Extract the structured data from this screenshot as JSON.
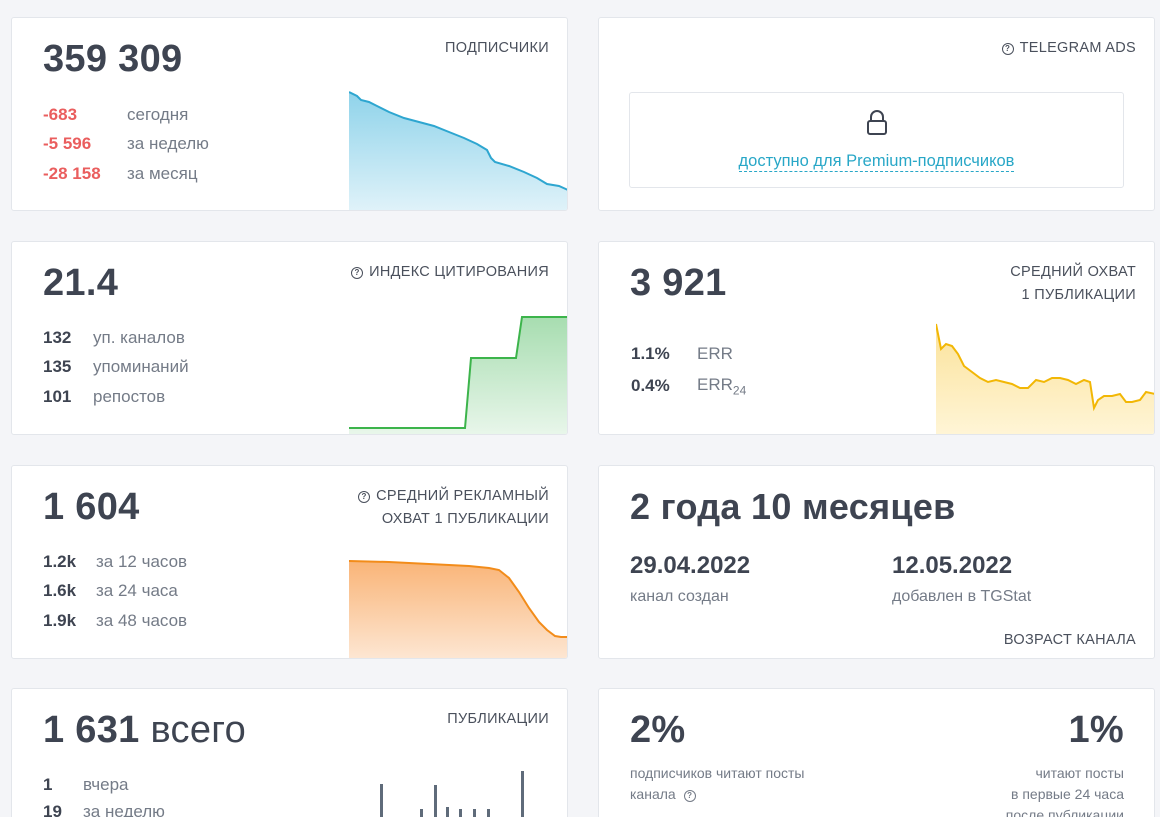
{
  "subscribers": {
    "value": "359 309",
    "label": "ПОДПИСЧИКИ",
    "rows": [
      {
        "value": "-683",
        "text": "сегодня"
      },
      {
        "value": "-5 596",
        "text": "за неделю"
      },
      {
        "value": "-28 158",
        "text": "за месяц"
      }
    ],
    "color": "#2ea6d0"
  },
  "telegram_ads": {
    "label": "TELEGRAM ADS",
    "lock_text": "доступно для Premium-подписчиков"
  },
  "citation": {
    "value": "21.4",
    "label": "ИНДЕКС ЦИТИРОВАНИЯ",
    "rows": [
      {
        "value": "132",
        "text": "уп. каналов"
      },
      {
        "value": "135",
        "text": "упоминаний"
      },
      {
        "value": "101",
        "text": "репостов"
      }
    ],
    "color": "#3cb44b"
  },
  "avg_reach": {
    "value": "3 921",
    "label_line1": "СРЕДНИЙ ОХВАТ",
    "label_line2": "1 ПУБЛИКАЦИИ",
    "rows": [
      {
        "value": "1.1%",
        "text": "ERR",
        "sub": ""
      },
      {
        "value": "0.4%",
        "text": "ERR",
        "sub": "24"
      }
    ],
    "color": "#f2b705"
  },
  "ad_reach": {
    "value": "1 604",
    "label_line1": "СРЕДНИЙ РЕКЛАМНЫЙ",
    "label_line2": "ОХВАТ 1 ПУБЛИКАЦИИ",
    "rows": [
      {
        "value": "1.2k",
        "text": "за 12 часов"
      },
      {
        "value": "1.6k",
        "text": "за 24 часа"
      },
      {
        "value": "1.9k",
        "text": "за 48 часов"
      }
    ],
    "color": "#f28c1a"
  },
  "age": {
    "value": "2 года 10 месяцев",
    "created_date": "29.04.2022",
    "created_label": "канал создан",
    "added_date": "12.05.2022",
    "added_label": "добавлен в TGStat",
    "label": "ВОЗРАСТ КАНАЛА"
  },
  "publications": {
    "value": "1 631",
    "suffix": "всего",
    "label": "ПУБЛИКАЦИИ",
    "rows": [
      {
        "value": "1",
        "text": "вчера"
      },
      {
        "value": "19",
        "text": "за неделю"
      }
    ],
    "color": "#5f6b7a"
  },
  "readers": {
    "left_value": "2%",
    "left_line1": "подписчиков читают посты",
    "left_line2": "канала",
    "right_value": "1%",
    "right_line1": "читают посты",
    "right_line2": "в первые 24 часа",
    "right_line3": "после публикации"
  }
}
